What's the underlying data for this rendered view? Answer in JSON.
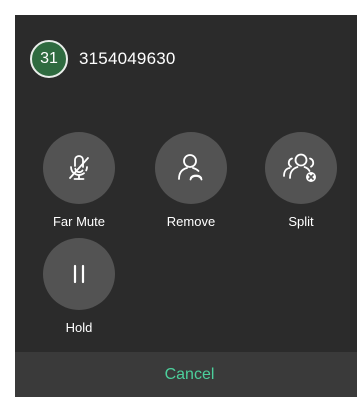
{
  "contact": {
    "avatar_text": "31",
    "number": "3154049630"
  },
  "actions": [
    {
      "label": "Far Mute",
      "icon": "mic-muted-icon"
    },
    {
      "label": "Remove",
      "icon": "remove-person-icon"
    },
    {
      "label": "Split",
      "icon": "split-group-icon"
    },
    {
      "label": "Hold",
      "icon": "pause-icon"
    }
  ],
  "footer": {
    "cancel_label": "Cancel"
  },
  "colors": {
    "dialog_bg": "#2b2b2b",
    "button_bg": "#535353",
    "avatar_bg": "#2f6b40",
    "accent": "#4ccf9c",
    "footer_bg": "#3a3a3a"
  }
}
